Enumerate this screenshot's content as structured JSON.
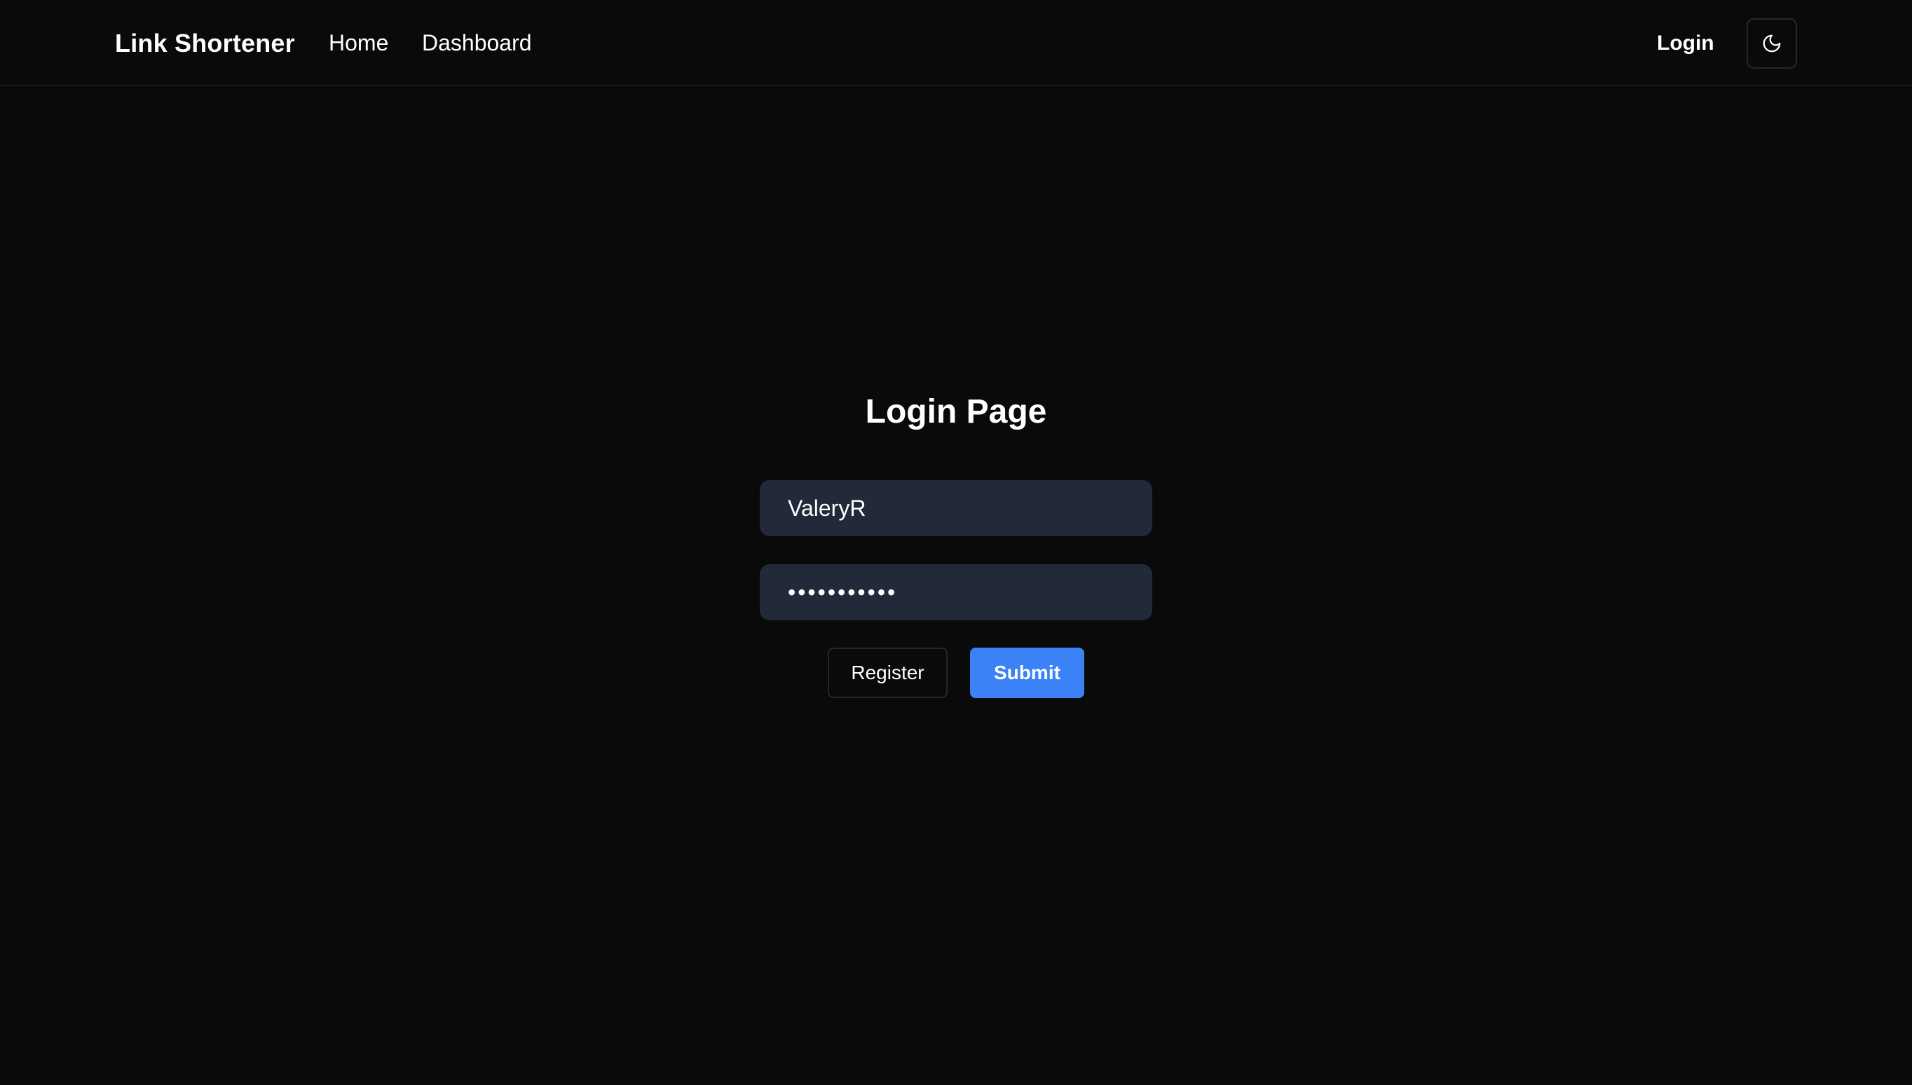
{
  "navbar": {
    "brand": "Link Shortener",
    "links": [
      {
        "label": "Home"
      },
      {
        "label": "Dashboard"
      }
    ],
    "login_label": "Login",
    "theme_icon": "moon-icon"
  },
  "main": {
    "title": "Login Page",
    "username_value": "ValeryR",
    "password_value": "•••••••••••",
    "register_label": "Register",
    "submit_label": "Submit"
  },
  "colors": {
    "background": "#0a0a0a",
    "input_background": "#222938",
    "accent": "#3b82f6"
  }
}
